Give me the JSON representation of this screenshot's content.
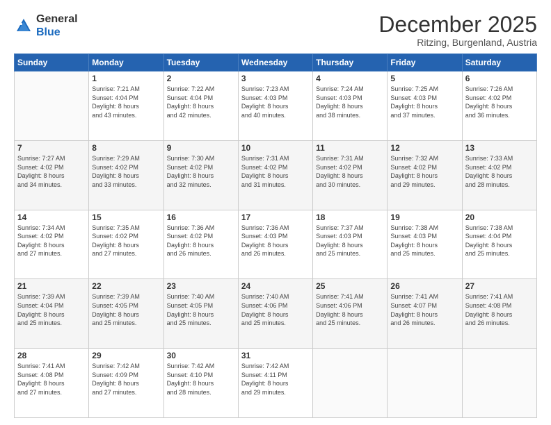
{
  "header": {
    "logo_general": "General",
    "logo_blue": "Blue",
    "month": "December 2025",
    "location": "Ritzing, Burgenland, Austria"
  },
  "weekdays": [
    "Sunday",
    "Monday",
    "Tuesday",
    "Wednesday",
    "Thursday",
    "Friday",
    "Saturday"
  ],
  "weeks": [
    [
      {
        "day": "",
        "info": ""
      },
      {
        "day": "1",
        "info": "Sunrise: 7:21 AM\nSunset: 4:04 PM\nDaylight: 8 hours\nand 43 minutes."
      },
      {
        "day": "2",
        "info": "Sunrise: 7:22 AM\nSunset: 4:04 PM\nDaylight: 8 hours\nand 42 minutes."
      },
      {
        "day": "3",
        "info": "Sunrise: 7:23 AM\nSunset: 4:03 PM\nDaylight: 8 hours\nand 40 minutes."
      },
      {
        "day": "4",
        "info": "Sunrise: 7:24 AM\nSunset: 4:03 PM\nDaylight: 8 hours\nand 38 minutes."
      },
      {
        "day": "5",
        "info": "Sunrise: 7:25 AM\nSunset: 4:03 PM\nDaylight: 8 hours\nand 37 minutes."
      },
      {
        "day": "6",
        "info": "Sunrise: 7:26 AM\nSunset: 4:02 PM\nDaylight: 8 hours\nand 36 minutes."
      }
    ],
    [
      {
        "day": "7",
        "info": "Sunrise: 7:27 AM\nSunset: 4:02 PM\nDaylight: 8 hours\nand 34 minutes."
      },
      {
        "day": "8",
        "info": "Sunrise: 7:29 AM\nSunset: 4:02 PM\nDaylight: 8 hours\nand 33 minutes."
      },
      {
        "day": "9",
        "info": "Sunrise: 7:30 AM\nSunset: 4:02 PM\nDaylight: 8 hours\nand 32 minutes."
      },
      {
        "day": "10",
        "info": "Sunrise: 7:31 AM\nSunset: 4:02 PM\nDaylight: 8 hours\nand 31 minutes."
      },
      {
        "day": "11",
        "info": "Sunrise: 7:31 AM\nSunset: 4:02 PM\nDaylight: 8 hours\nand 30 minutes."
      },
      {
        "day": "12",
        "info": "Sunrise: 7:32 AM\nSunset: 4:02 PM\nDaylight: 8 hours\nand 29 minutes."
      },
      {
        "day": "13",
        "info": "Sunrise: 7:33 AM\nSunset: 4:02 PM\nDaylight: 8 hours\nand 28 minutes."
      }
    ],
    [
      {
        "day": "14",
        "info": "Sunrise: 7:34 AM\nSunset: 4:02 PM\nDaylight: 8 hours\nand 27 minutes."
      },
      {
        "day": "15",
        "info": "Sunrise: 7:35 AM\nSunset: 4:02 PM\nDaylight: 8 hours\nand 27 minutes."
      },
      {
        "day": "16",
        "info": "Sunrise: 7:36 AM\nSunset: 4:02 PM\nDaylight: 8 hours\nand 26 minutes."
      },
      {
        "day": "17",
        "info": "Sunrise: 7:36 AM\nSunset: 4:03 PM\nDaylight: 8 hours\nand 26 minutes."
      },
      {
        "day": "18",
        "info": "Sunrise: 7:37 AM\nSunset: 4:03 PM\nDaylight: 8 hours\nand 25 minutes."
      },
      {
        "day": "19",
        "info": "Sunrise: 7:38 AM\nSunset: 4:03 PM\nDaylight: 8 hours\nand 25 minutes."
      },
      {
        "day": "20",
        "info": "Sunrise: 7:38 AM\nSunset: 4:04 PM\nDaylight: 8 hours\nand 25 minutes."
      }
    ],
    [
      {
        "day": "21",
        "info": "Sunrise: 7:39 AM\nSunset: 4:04 PM\nDaylight: 8 hours\nand 25 minutes."
      },
      {
        "day": "22",
        "info": "Sunrise: 7:39 AM\nSunset: 4:05 PM\nDaylight: 8 hours\nand 25 minutes."
      },
      {
        "day": "23",
        "info": "Sunrise: 7:40 AM\nSunset: 4:05 PM\nDaylight: 8 hours\nand 25 minutes."
      },
      {
        "day": "24",
        "info": "Sunrise: 7:40 AM\nSunset: 4:06 PM\nDaylight: 8 hours\nand 25 minutes."
      },
      {
        "day": "25",
        "info": "Sunrise: 7:41 AM\nSunset: 4:06 PM\nDaylight: 8 hours\nand 25 minutes."
      },
      {
        "day": "26",
        "info": "Sunrise: 7:41 AM\nSunset: 4:07 PM\nDaylight: 8 hours\nand 26 minutes."
      },
      {
        "day": "27",
        "info": "Sunrise: 7:41 AM\nSunset: 4:08 PM\nDaylight: 8 hours\nand 26 minutes."
      }
    ],
    [
      {
        "day": "28",
        "info": "Sunrise: 7:41 AM\nSunset: 4:08 PM\nDaylight: 8 hours\nand 27 minutes."
      },
      {
        "day": "29",
        "info": "Sunrise: 7:42 AM\nSunset: 4:09 PM\nDaylight: 8 hours\nand 27 minutes."
      },
      {
        "day": "30",
        "info": "Sunrise: 7:42 AM\nSunset: 4:10 PM\nDaylight: 8 hours\nand 28 minutes."
      },
      {
        "day": "31",
        "info": "Sunrise: 7:42 AM\nSunset: 4:11 PM\nDaylight: 8 hours\nand 29 minutes."
      },
      {
        "day": "",
        "info": ""
      },
      {
        "day": "",
        "info": ""
      },
      {
        "day": "",
        "info": ""
      }
    ]
  ]
}
